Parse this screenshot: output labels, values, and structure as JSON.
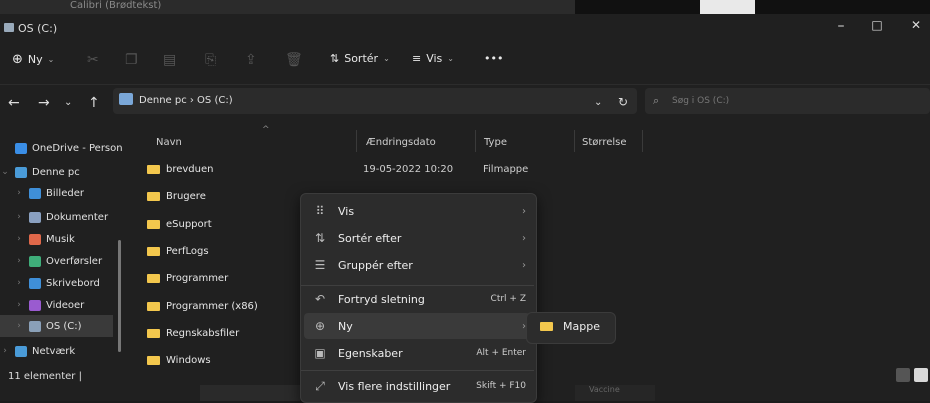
{
  "background": {
    "ribbon_font": "Calibri (Brødtekst)"
  },
  "window": {
    "title": "OS (C:)",
    "minimize": "–",
    "maximize": "□",
    "close": "✕"
  },
  "toolbar": {
    "new_label": "Ny",
    "sort_label": "Sortér",
    "view_label": "Vis",
    "more_label": "•••"
  },
  "address": {
    "path": "Denne pc  ›  OS (C:)",
    "search_placeholder": "Søg i OS (C:)"
  },
  "sidebar": {
    "items": [
      {
        "label": "OneDrive - Person",
        "icon": "cloud-icon",
        "color": "#3a8ee6"
      },
      {
        "label": "Denne pc",
        "icon": "computer-icon",
        "color": "#4a9bd8"
      },
      {
        "label": "Billeder",
        "icon": "pictures-icon",
        "color": "#3f8fd8"
      },
      {
        "label": "Dokumenter",
        "icon": "documents-icon",
        "color": "#8aa0c0"
      },
      {
        "label": "Musik",
        "icon": "music-icon",
        "color": "#e0684a"
      },
      {
        "label": "Overførsler",
        "icon": "download-icon",
        "color": "#3fae7a"
      },
      {
        "label": "Skrivebord",
        "icon": "desktop-icon",
        "color": "#3f8fd8"
      },
      {
        "label": "Videoer",
        "icon": "videos-icon",
        "color": "#9a5bd0"
      },
      {
        "label": "OS (C:)",
        "icon": "drive-icon",
        "color": "#8aa0b8"
      },
      {
        "label": "Netværk",
        "icon": "network-icon",
        "color": "#4a9bd8"
      }
    ]
  },
  "columns": {
    "name": "Navn",
    "date": "Ændringsdato",
    "type": "Type",
    "size": "Størrelse"
  },
  "files": [
    {
      "name": "brevduen",
      "date": "19-05-2022 10:20",
      "type": "Filmappe"
    },
    {
      "name": "Brugere",
      "date": "",
      "type": ""
    },
    {
      "name": "eSupport",
      "date": "",
      "type": ""
    },
    {
      "name": "PerfLogs",
      "date": "",
      "type": ""
    },
    {
      "name": "Programmer",
      "date": "",
      "type": ""
    },
    {
      "name": "Programmer (x86)",
      "date": "",
      "type": ""
    },
    {
      "name": "Regnskabsfiler",
      "date": "",
      "type": ""
    },
    {
      "name": "Windows",
      "date": "",
      "type": ""
    }
  ],
  "status": {
    "count": "11 elementer"
  },
  "context_menu": {
    "items": [
      {
        "label": "Vis",
        "icon": "grid-icon",
        "shortcut": ""
      },
      {
        "label": "Sortér efter",
        "icon": "sort-icon",
        "shortcut": ""
      },
      {
        "label": "Gruppér efter",
        "icon": "group-icon",
        "shortcut": ""
      },
      {
        "label": "Fortryd sletning",
        "icon": "undo-icon",
        "shortcut": "Ctrl + Z"
      },
      {
        "label": "Ny",
        "icon": "new-icon",
        "shortcut": ""
      },
      {
        "label": "Egenskaber",
        "icon": "properties-icon",
        "shortcut": "Alt + Enter"
      },
      {
        "label": "Vis flere indstillinger",
        "icon": "more-options-icon",
        "shortcut": "Skift + F10"
      }
    ],
    "submenu_item": "Mappe"
  },
  "taskbar_hint": "Vaccine"
}
